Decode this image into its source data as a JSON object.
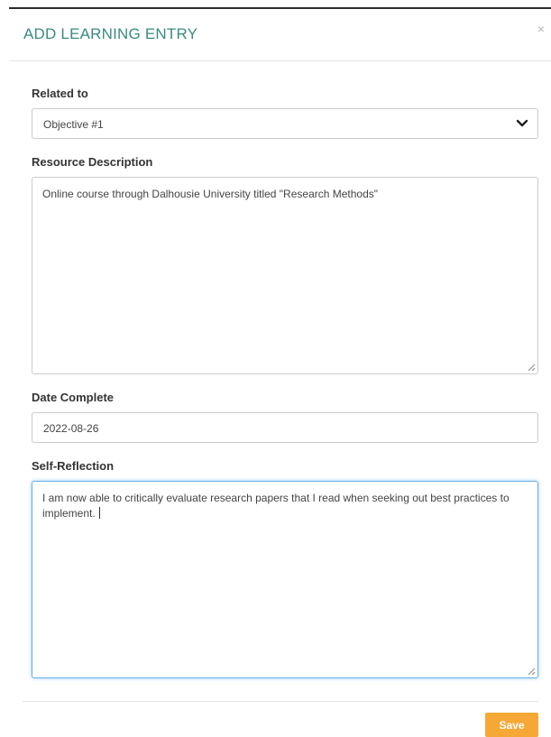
{
  "modal": {
    "title": "ADD LEARNING ENTRY",
    "close_symbol": "×"
  },
  "form": {
    "related_to": {
      "label": "Related to",
      "selected": "Objective #1",
      "icon": "chevron-down-icon"
    },
    "resource_description": {
      "label": "Resource Description",
      "value": "Online course through Dalhousie University titled \"Research Methods\""
    },
    "date_complete": {
      "label": "Date Complete",
      "value": "2022-08-26"
    },
    "self_reflection": {
      "label": "Self-Reflection",
      "value": "I am now able to critically evaluate research papers that I read when seeking out best practices to implement."
    }
  },
  "footer": {
    "save_label": "Save"
  },
  "colors": {
    "title": "#3a8b80",
    "save_button": "#f6a836",
    "focus_border": "#66afe9"
  }
}
